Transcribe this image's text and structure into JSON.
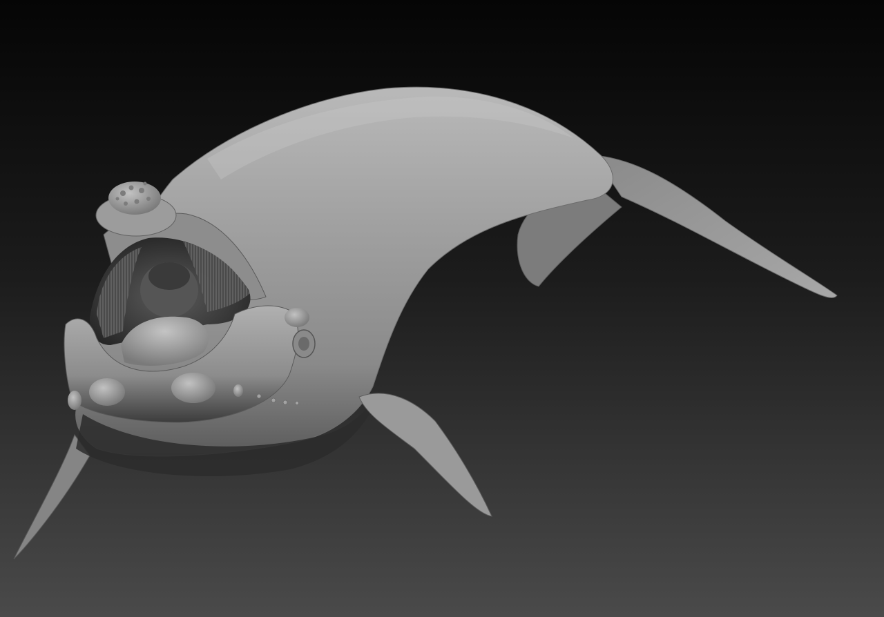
{
  "scene": {
    "subject": "whale-sculpt",
    "render_style": "grayscale-clay",
    "colors": {
      "background_top": "#050505",
      "background_bottom": "#4a4a4a",
      "body_light": "#b9b9b9",
      "body_mid": "#8f8f8f",
      "body_dark": "#4e4e4e",
      "mouth_interior": "#3a3a3a",
      "baleen": "#6d6d6d",
      "callosity": "#a5a5a5"
    }
  }
}
